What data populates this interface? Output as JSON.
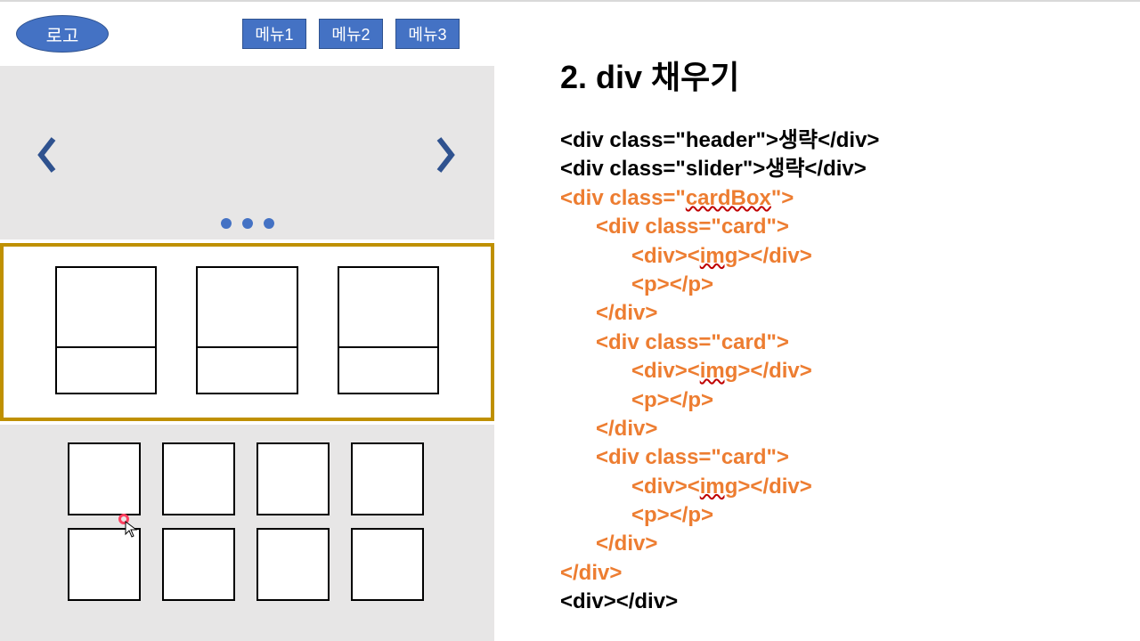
{
  "header": {
    "logo": "로고",
    "menus": [
      "메뉴1",
      "메뉴2",
      "메뉴3"
    ]
  },
  "right": {
    "title": "2. div 채우기",
    "lines": [
      {
        "cls": "black",
        "indent": 0,
        "text": "<div class=\"header\">생략</div>"
      },
      {
        "cls": "black",
        "indent": 0,
        "text": "<div class=\"slider\">생략</div>"
      },
      {
        "cls": "orange",
        "indent": 0,
        "html": "&lt;div class=&quot;<span class='u'>cardBox</span>&quot;&gt;"
      },
      {
        "cls": "orange",
        "indent": 1,
        "text": "<div class=\"card\">"
      },
      {
        "cls": "orange",
        "indent": 2,
        "html": "&lt;div&gt;&lt;<span class='u'>img</span>&gt;&lt;/div&gt;"
      },
      {
        "cls": "orange",
        "indent": 2,
        "text": "<p></p>"
      },
      {
        "cls": "orange",
        "indent": 1,
        "text": "</div>"
      },
      {
        "cls": "orange",
        "indent": 1,
        "text": "<div class=\"card\">"
      },
      {
        "cls": "orange",
        "indent": 2,
        "html": "&lt;div&gt;&lt;<span class='u'>img</span>&gt;&lt;/div&gt;"
      },
      {
        "cls": "orange",
        "indent": 2,
        "text": "<p></p>"
      },
      {
        "cls": "orange",
        "indent": 1,
        "text": "</div>"
      },
      {
        "cls": "orange",
        "indent": 1,
        "text": "<div class=\"card\">"
      },
      {
        "cls": "orange",
        "indent": 2,
        "html": "&lt;div&gt;&lt;<span class='u'>img</span>&gt;&lt;/div&gt;"
      },
      {
        "cls": "orange",
        "indent": 2,
        "text": "<p></p>"
      },
      {
        "cls": "orange",
        "indent": 1,
        "text": "</div>"
      },
      {
        "cls": "orange",
        "indent": 0,
        "text": "</div>"
      },
      {
        "cls": "black",
        "indent": 0,
        "text": "<div></div>"
      }
    ]
  }
}
